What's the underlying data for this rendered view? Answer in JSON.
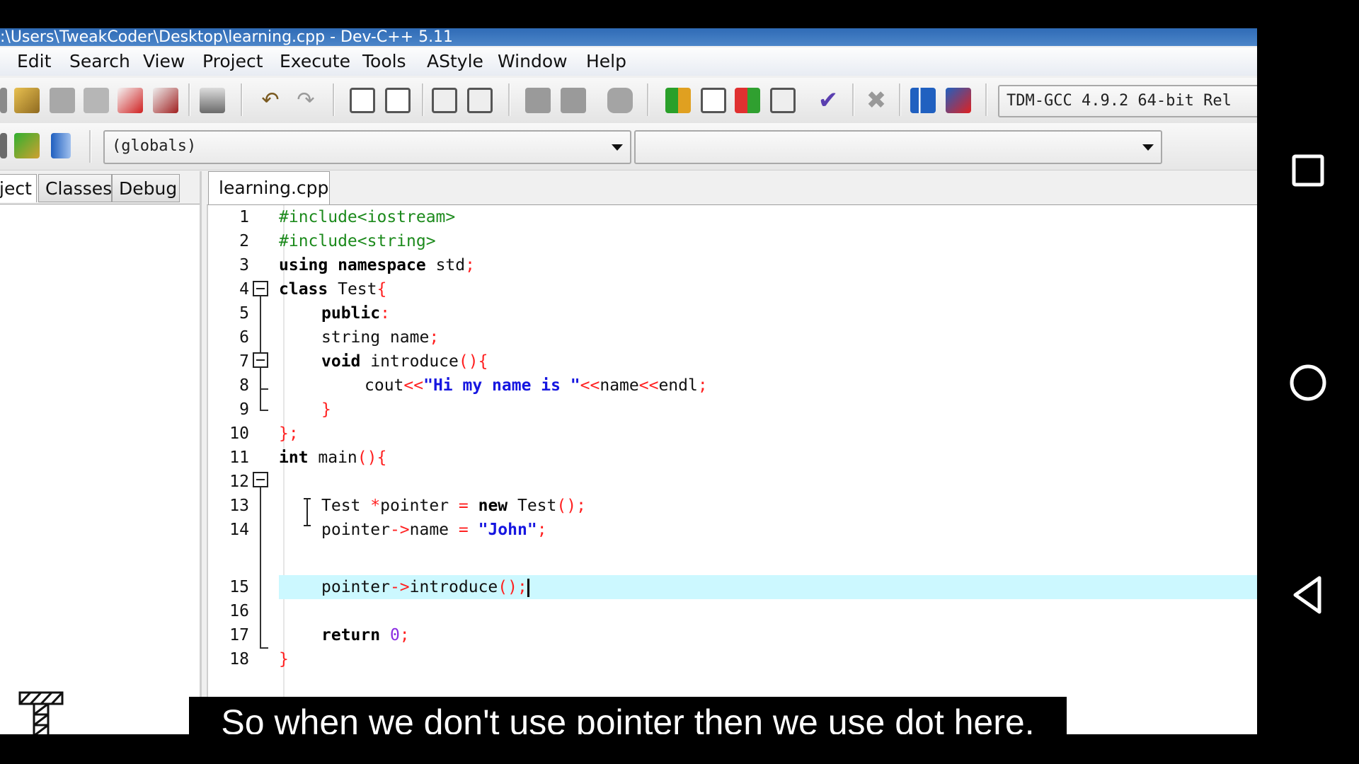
{
  "window": {
    "title": ":\\Users\\TweakCoder\\Desktop\\learning.cpp - Dev-C++ 5.11"
  },
  "menu": [
    "Edit",
    "Search",
    "View",
    "Project",
    "Execute",
    "Tools",
    "AStyle",
    "Window",
    "Help"
  ],
  "toolbar": {
    "compiler": "TDM-GCC 4.9.2 64-bit Rel"
  },
  "scope": {
    "globals": "(globals)",
    "members": ""
  },
  "left_tabs": [
    "ject",
    "Classes",
    "Debug"
  ],
  "editor_tab": "learning.cpp",
  "line_numbers": [
    "1",
    "2",
    "3",
    "4",
    "5",
    "6",
    "7",
    "8",
    "9",
    "10",
    "11",
    "12",
    "13",
    "14",
    "15",
    "16",
    "17",
    "18"
  ],
  "code": {
    "l1": "#include<iostream>",
    "l2": "#include<string>",
    "l3_kw": "using namespace",
    "l3_rest": " std",
    "semi": ";",
    "l4_kw": "class",
    "l4_name": " Test",
    "brace_open": "{",
    "l5_kw": "public",
    "colon": ":",
    "l6": "string name",
    "l7_kw": "void",
    "l7_name": " introduce",
    "parens_brace": "(){",
    "l8_a": "cout",
    "shl": "<<",
    "l8_str": "\"Hi my name is \"",
    "l8_b": "name",
    "l8_c": "endl",
    "brace_close": "}",
    "l10": "};",
    "l11_a": "int",
    "l11_b": " main",
    "l13_a": "Test ",
    "star": "*",
    "l13_b": "pointer ",
    "eq": "=",
    "l13_kw": " new",
    "l13_c": " Test",
    "parens": "()",
    "l14_a": "pointer",
    "arrow": "->",
    "l14_b": "name ",
    "l14_str": " \"John\"",
    "l15_a": "pointer",
    "l15_b": "introduce",
    "l17_kw": "return",
    "l17_num": " 0"
  },
  "subtitle": "So when we don't use pointer then we use dot here.",
  "navbar": [
    "recents-button",
    "home-button",
    "back-button"
  ]
}
